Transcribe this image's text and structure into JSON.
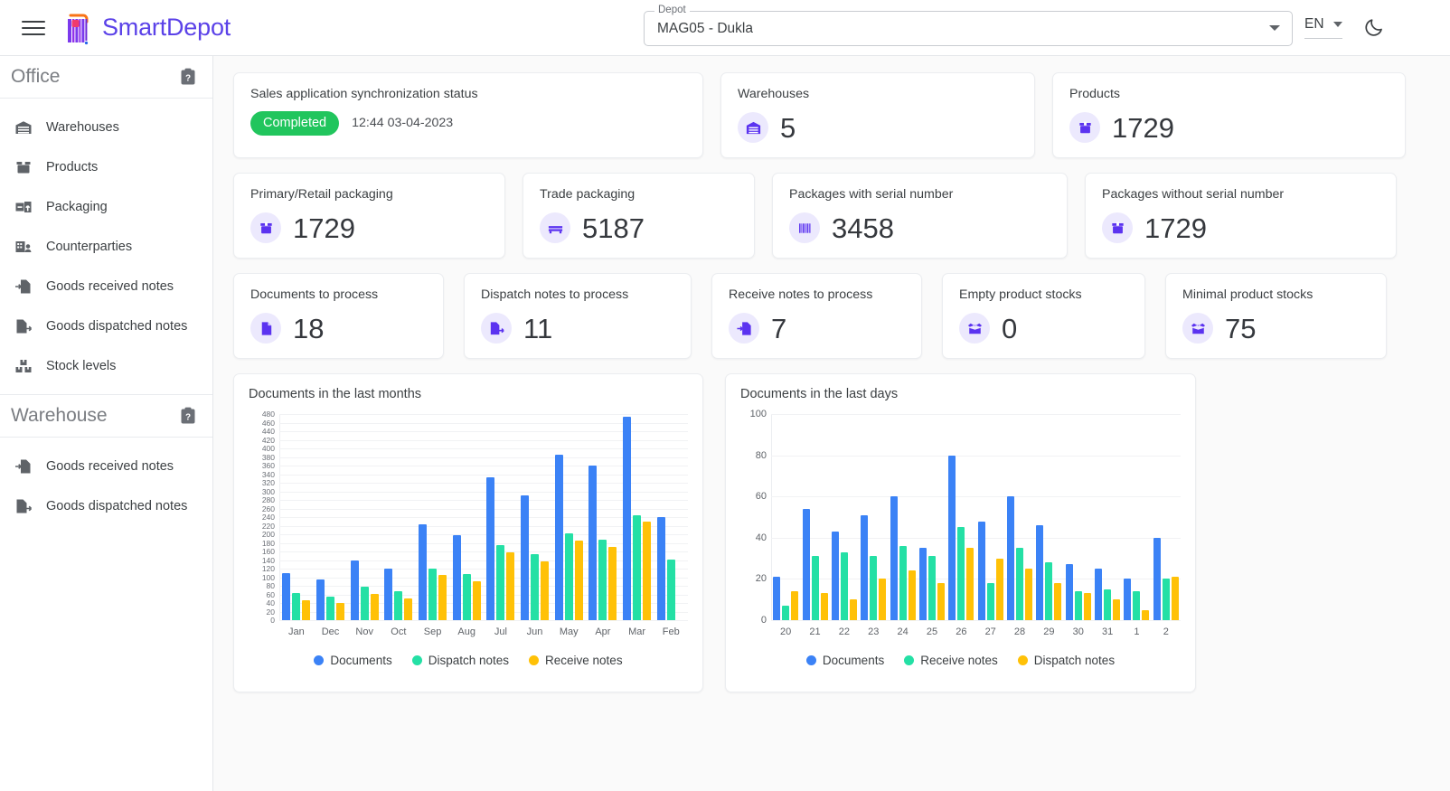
{
  "app": {
    "brand": "SmartDepot",
    "menu_icon": "hamburger-icon"
  },
  "header": {
    "depot_legend": "Depot",
    "depot_value": "MAG05 - Dukla",
    "language": "EN",
    "theme_icon": "moon-icon"
  },
  "sidebar": {
    "groups": [
      {
        "title": "Office",
        "badge_icon": "clipboard-question-icon",
        "items": [
          {
            "label": "Warehouses",
            "icon": "warehouse-icon"
          },
          {
            "label": "Products",
            "icon": "box-icon"
          },
          {
            "label": "Packaging",
            "icon": "packaging-icon"
          },
          {
            "label": "Counterparties",
            "icon": "counterparties-icon"
          },
          {
            "label": "Goods received notes",
            "icon": "goods-received-icon"
          },
          {
            "label": "Goods dispatched notes",
            "icon": "goods-dispatched-icon"
          },
          {
            "label": "Stock levels",
            "icon": "stock-levels-icon"
          }
        ]
      },
      {
        "title": "Warehouse",
        "badge_icon": "clipboard-question-icon",
        "items": [
          {
            "label": "Goods received notes",
            "icon": "goods-received-icon"
          },
          {
            "label": "Goods dispatched notes",
            "icon": "goods-dispatched-icon"
          }
        ]
      }
    ]
  },
  "sync_card": {
    "title": "Sales application synchronization status",
    "status": "Completed",
    "status_color": "#21c55d",
    "timestamp": "12:44 03-04-2023"
  },
  "stats": {
    "row1": [
      {
        "title": "Warehouses",
        "value": "5",
        "icon": "warehouse-icon"
      },
      {
        "title": "Products",
        "value": "1729",
        "icon": "box-icon"
      }
    ],
    "row2": [
      {
        "title": "Primary/Retail packaging",
        "value": "1729",
        "icon": "box-icon"
      },
      {
        "title": "Trade packaging",
        "value": "5187",
        "icon": "pallet-icon"
      },
      {
        "title": "Packages with serial number",
        "value": "3458",
        "icon": "barcode-icon"
      },
      {
        "title": "Packages without serial number",
        "value": "1729",
        "icon": "box-icon"
      }
    ],
    "row3": [
      {
        "title": "Documents to process",
        "value": "18",
        "icon": "document-icon"
      },
      {
        "title": "Dispatch notes to process",
        "value": "11",
        "icon": "goods-dispatched-icon"
      },
      {
        "title": "Receive notes to process",
        "value": "7",
        "icon": "goods-received-icon"
      },
      {
        "title": "Empty product stocks",
        "value": "0",
        "icon": "open-box-icon"
      },
      {
        "title": "Minimal product stocks",
        "value": "75",
        "icon": "open-box-icon"
      }
    ]
  },
  "accent": {
    "icon_purple": "#5b33f0",
    "icon_bubble": "#ece9fd",
    "brand_purple": "#5b42e8",
    "series_blue": "#3b82f6",
    "series_green": "#24e0a5",
    "series_yellow": "#ffc107"
  },
  "chart_data": [
    {
      "type": "bar",
      "title": "Documents in the last months",
      "xlabel": "",
      "ylabel": "",
      "ylim": [
        0,
        480
      ],
      "ytick_step": 20,
      "grid": true,
      "legend_position": "bottom",
      "categories": [
        "Jan",
        "Dec",
        "Nov",
        "Oct",
        "Sep",
        "Aug",
        "Jul",
        "Jun",
        "May",
        "Apr",
        "Mar",
        "Feb"
      ],
      "series": [
        {
          "name": "Documents",
          "color": "#3b82f6",
          "values": [
            110,
            95,
            140,
            120,
            224,
            197,
            332,
            291,
            385,
            359,
            473,
            240
          ]
        },
        {
          "name": "Dispatch notes",
          "color": "#24e0a5",
          "values": [
            63,
            55,
            78,
            67,
            121,
            107,
            175,
            154,
            202,
            187,
            245,
            141
          ]
        },
        {
          "name": "Receive notes",
          "color": "#ffc107",
          "values": [
            47,
            39,
            62,
            50,
            105,
            90,
            158,
            137,
            186,
            171,
            229,
            0
          ]
        }
      ]
    },
    {
      "type": "bar",
      "title": "Documents in the last days",
      "xlabel": "",
      "ylabel": "",
      "ylim": [
        0,
        100
      ],
      "ytick_step": 20,
      "grid": true,
      "legend_position": "bottom",
      "categories": [
        "20",
        "21",
        "22",
        "23",
        "24",
        "25",
        "26",
        "27",
        "28",
        "29",
        "30",
        "31",
        "1",
        "2"
      ],
      "series": [
        {
          "name": "Documents",
          "color": "#3b82f6",
          "values": [
            21,
            54,
            43,
            51,
            60,
            35,
            80,
            48,
            60,
            46,
            27,
            25,
            20,
            40
          ]
        },
        {
          "name": "Receive notes",
          "color": "#24e0a5",
          "values": [
            7,
            31,
            33,
            31,
            36,
            31,
            45,
            18,
            35,
            28,
            14,
            15,
            14,
            20
          ]
        },
        {
          "name": "Dispatch notes",
          "color": "#ffc107",
          "values": [
            14,
            13,
            10,
            20,
            24,
            18,
            35,
            30,
            25,
            18,
            13,
            10,
            5,
            21
          ]
        }
      ]
    }
  ]
}
